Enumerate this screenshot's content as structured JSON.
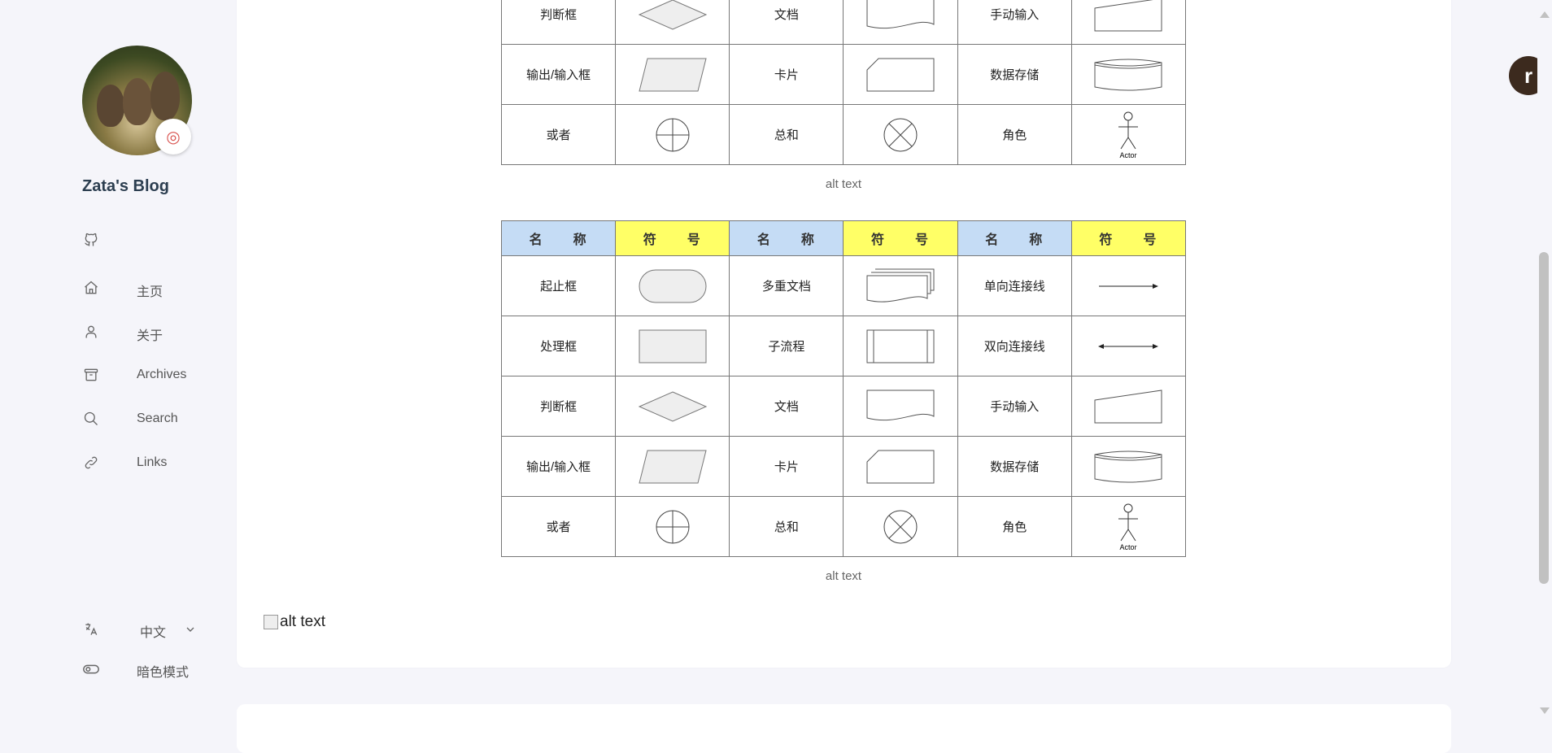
{
  "sidebar": {
    "blog_title": "Zata's Blog",
    "nav": [
      {
        "label": "主页",
        "icon": "home-icon"
      },
      {
        "label": "关于",
        "icon": "user-icon"
      },
      {
        "label": "Archives",
        "icon": "archive-icon"
      },
      {
        "label": "Search",
        "icon": "search-icon"
      },
      {
        "label": "Links",
        "icon": "link-icon"
      }
    ],
    "language": "中文",
    "dark_mode": "暗色模式"
  },
  "table": {
    "header_name": "名　　称",
    "header_symbol": "符　　号",
    "rows": [
      [
        "起止框",
        "多重文档",
        "单向连接线"
      ],
      [
        "处理框",
        "子流程",
        "双向连接线"
      ],
      [
        "判断框",
        "文档",
        "手动输入"
      ],
      [
        "输出/输入框",
        "卡片",
        "数据存储"
      ],
      [
        "或者",
        "总和",
        "角色"
      ]
    ],
    "actor_label": "Actor"
  },
  "captions": {
    "first": "alt text",
    "second": "alt text",
    "broken_image": "alt text"
  },
  "float_button": "r"
}
